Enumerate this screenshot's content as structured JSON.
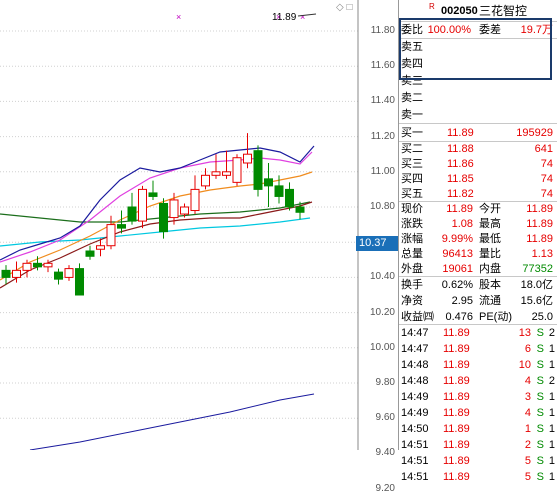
{
  "stock": {
    "code": "002050",
    "name": "三花智控",
    "badge": "R"
  },
  "chart": {
    "high_marker": "11.89",
    "current_price": "10.37",
    "price_axis": [
      "11.80",
      "11.60",
      "11.40",
      "11.20",
      "11.00",
      "10.80",
      "10.60",
      "10.40",
      "10.20",
      "10.00",
      "9.80",
      "9.60",
      "9.40",
      "9.20"
    ],
    "candles": [
      {
        "o": 10.44,
        "c": 10.4,
        "h": 10.47,
        "l": 10.36
      },
      {
        "o": 10.4,
        "c": 10.44,
        "h": 10.49,
        "l": 10.37
      },
      {
        "o": 10.44,
        "c": 10.48,
        "h": 10.5,
        "l": 10.4
      },
      {
        "o": 10.48,
        "c": 10.46,
        "h": 10.52,
        "l": 10.44
      },
      {
        "o": 10.46,
        "c": 10.48,
        "h": 10.5,
        "l": 10.43
      },
      {
        "o": 10.43,
        "c": 10.39,
        "h": 10.45,
        "l": 10.36
      },
      {
        "o": 10.4,
        "c": 10.45,
        "h": 10.47,
        "l": 10.38
      },
      {
        "o": 10.45,
        "c": 10.3,
        "h": 10.48,
        "l": 10.3
      },
      {
        "o": 10.55,
        "c": 10.52,
        "h": 10.58,
        "l": 10.5
      },
      {
        "o": 10.56,
        "c": 10.58,
        "h": 10.62,
        "l": 10.52
      },
      {
        "o": 10.58,
        "c": 10.7,
        "h": 10.75,
        "l": 10.56
      },
      {
        "o": 10.7,
        "c": 10.68,
        "h": 10.78,
        "l": 10.65
      },
      {
        "o": 10.8,
        "c": 10.72,
        "h": 10.88,
        "l": 10.7
      },
      {
        "o": 10.72,
        "c": 10.9,
        "h": 10.92,
        "l": 10.68
      },
      {
        "o": 10.88,
        "c": 10.86,
        "h": 10.95,
        "l": 10.84
      },
      {
        "o": 10.82,
        "c": 10.66,
        "h": 10.85,
        "l": 10.62
      },
      {
        "o": 10.74,
        "c": 10.84,
        "h": 10.88,
        "l": 10.7
      },
      {
        "o": 10.76,
        "c": 10.8,
        "h": 10.82,
        "l": 10.74
      },
      {
        "o": 10.78,
        "c": 10.9,
        "h": 10.98,
        "l": 10.76
      },
      {
        "o": 10.92,
        "c": 10.98,
        "h": 11.02,
        "l": 10.9
      },
      {
        "o": 10.98,
        "c": 11.0,
        "h": 11.1,
        "l": 10.96
      },
      {
        "o": 10.98,
        "c": 11.0,
        "h": 11.12,
        "l": 10.96
      },
      {
        "o": 10.94,
        "c": 11.08,
        "h": 11.1,
        "l": 10.92
      },
      {
        "o": 11.05,
        "c": 11.1,
        "h": 11.22,
        "l": 11.02
      },
      {
        "o": 11.12,
        "c": 10.9,
        "h": 11.15,
        "l": 10.86
      },
      {
        "o": 10.96,
        "c": 10.92,
        "h": 11.05,
        "l": 10.8
      },
      {
        "o": 10.92,
        "c": 10.86,
        "h": 10.98,
        "l": 10.82
      },
      {
        "o": 10.9,
        "c": 10.8,
        "h": 10.94,
        "l": 10.78
      },
      {
        "o": 10.8,
        "c": 10.77,
        "h": 10.83,
        "l": 10.73
      }
    ]
  },
  "panel": {
    "wb": {
      "label": "委比",
      "value": "100.00%",
      "label2": "委差",
      "value2": "19.7万"
    },
    "asks": [
      {
        "label": "卖五"
      },
      {
        "label": "卖四"
      },
      {
        "label": "卖三"
      },
      {
        "label": "卖二"
      },
      {
        "label": "卖一"
      }
    ],
    "bids": [
      {
        "label": "买一",
        "price": "11.89",
        "vol": "195929"
      },
      {
        "label": "买二",
        "price": "11.88",
        "vol": "641"
      },
      {
        "label": "买三",
        "price": "11.86",
        "vol": "74"
      },
      {
        "label": "买四",
        "price": "11.85",
        "vol": "74"
      },
      {
        "label": "买五",
        "price": "11.82",
        "vol": "74"
      }
    ],
    "quotes": [
      {
        "l1": "现价",
        "v1": "11.89",
        "c1": "red",
        "l2": "今开",
        "v2": "11.89",
        "c2": "red"
      },
      {
        "l1": "涨跌",
        "v1": "1.08",
        "c1": "red",
        "l2": "最高",
        "v2": "11.89",
        "c2": "red"
      },
      {
        "l1": "涨幅",
        "v1": "9.99%",
        "c1": "red",
        "l2": "最低",
        "v2": "11.89",
        "c2": "red"
      },
      {
        "l1": "总量",
        "v1": "96413",
        "c1": "red",
        "l2": "量比",
        "v2": "1.13",
        "c2": "red"
      },
      {
        "l1": "外盘",
        "v1": "19061",
        "c1": "red",
        "l2": "内盘",
        "v2": "77352",
        "c2": "green"
      }
    ],
    "fin": [
      {
        "l1": "换手",
        "v1": "0.62%",
        "l2": "股本",
        "v2": "18.0亿"
      },
      {
        "l1": "净资",
        "v1": "2.95",
        "l2": "流通",
        "v2": "15.6亿"
      },
      {
        "l1": "收益㈣",
        "v1": "0.476",
        "l2": "PE(动)",
        "v2": "25.0"
      }
    ],
    "ticks": [
      {
        "t": "14:47",
        "p": "11.89",
        "v": "13",
        "s": "S",
        "c": "2"
      },
      {
        "t": "14:47",
        "p": "11.89",
        "v": "6",
        "s": "S",
        "c": "1"
      },
      {
        "t": "14:48",
        "p": "11.89",
        "v": "10",
        "s": "S",
        "c": "1"
      },
      {
        "t": "14:48",
        "p": "11.89",
        "v": "4",
        "s": "S",
        "c": "2"
      },
      {
        "t": "14:49",
        "p": "11.89",
        "v": "3",
        "s": "S",
        "c": "1"
      },
      {
        "t": "14:49",
        "p": "11.89",
        "v": "4",
        "s": "S",
        "c": "1"
      },
      {
        "t": "14:50",
        "p": "11.89",
        "v": "1",
        "s": "S",
        "c": "1"
      },
      {
        "t": "14:51",
        "p": "11.89",
        "v": "2",
        "s": "S",
        "c": "1"
      },
      {
        "t": "14:51",
        "p": "11.89",
        "v": "5",
        "s": "S",
        "c": "1"
      },
      {
        "t": "14:51",
        "p": "11.89",
        "v": "5",
        "s": "S",
        "c": "1"
      }
    ]
  }
}
